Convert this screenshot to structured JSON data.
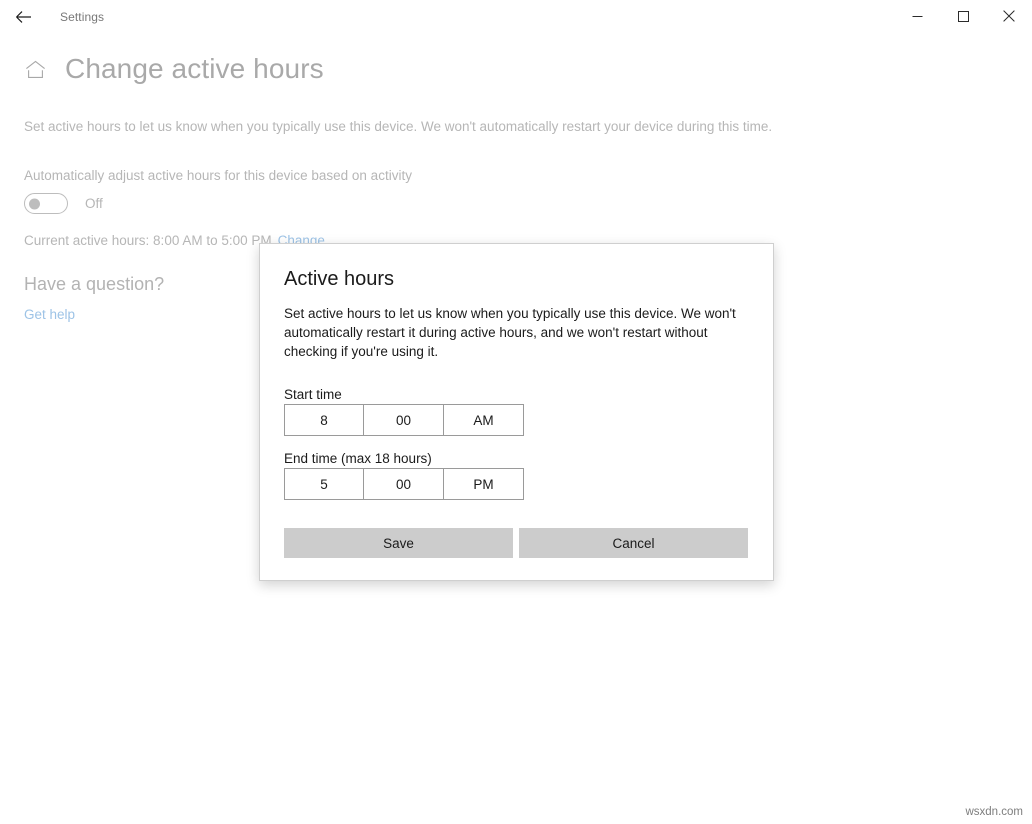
{
  "window": {
    "titlebar_title": "Settings",
    "back_icon": "back-arrow-icon",
    "minimize_label": "─",
    "maximize_label": "□",
    "close_label": "✕"
  },
  "page": {
    "home_icon": "home-icon",
    "title": "Change active hours",
    "description": "Set active hours to let us know when you typically use this device. We won't automatically restart your device during this time.",
    "auto_adjust_label": "Automatically adjust active hours for this device based on activity",
    "toggle_state": "Off",
    "current_hours_text": "Current active hours: 8:00 AM to 5:00 PM",
    "change_link": "Change",
    "question_heading": "Have a question?",
    "get_help_link": "Get help"
  },
  "dialog": {
    "title": "Active hours",
    "description": "Set active hours to let us know when you typically use this device. We won't automatically restart it during active hours, and we won't restart without checking if you're using it.",
    "start_label": "Start time",
    "start_hour": "8",
    "start_minute": "00",
    "start_meridiem": "AM",
    "end_label": "End time (max 18 hours)",
    "end_hour": "5",
    "end_minute": "00",
    "end_meridiem": "PM",
    "save_label": "Save",
    "cancel_label": "Cancel"
  },
  "watermark": "wsxdn.com",
  "colors": {
    "link": "#9dc3e6",
    "muted_text": "#b6b6b6",
    "dialog_text": "#1b1b1b",
    "button_bg": "#cccccc",
    "field_border": "#9a9a9a"
  }
}
